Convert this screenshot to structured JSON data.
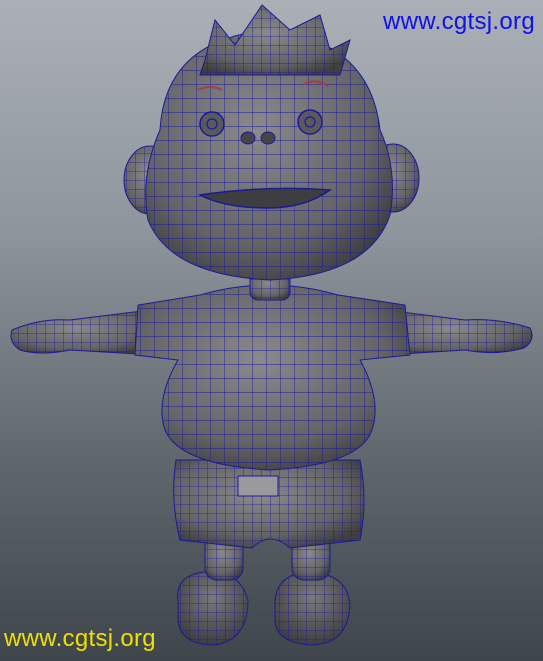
{
  "viewport": {
    "background_top": "#aab0b6",
    "background_bottom": "#3f464b",
    "model_subject": "cartoon monkey character",
    "display_mode": "wireframe on shaded",
    "wire_color": "#1a1a9a",
    "shade_color": "#6b6b6e"
  },
  "watermark_top": {
    "text": "www.cgtsj.org",
    "color": "#1010ee"
  },
  "watermark_bottom": {
    "text": "www.cgtsj.org",
    "color": "#f0e000"
  }
}
